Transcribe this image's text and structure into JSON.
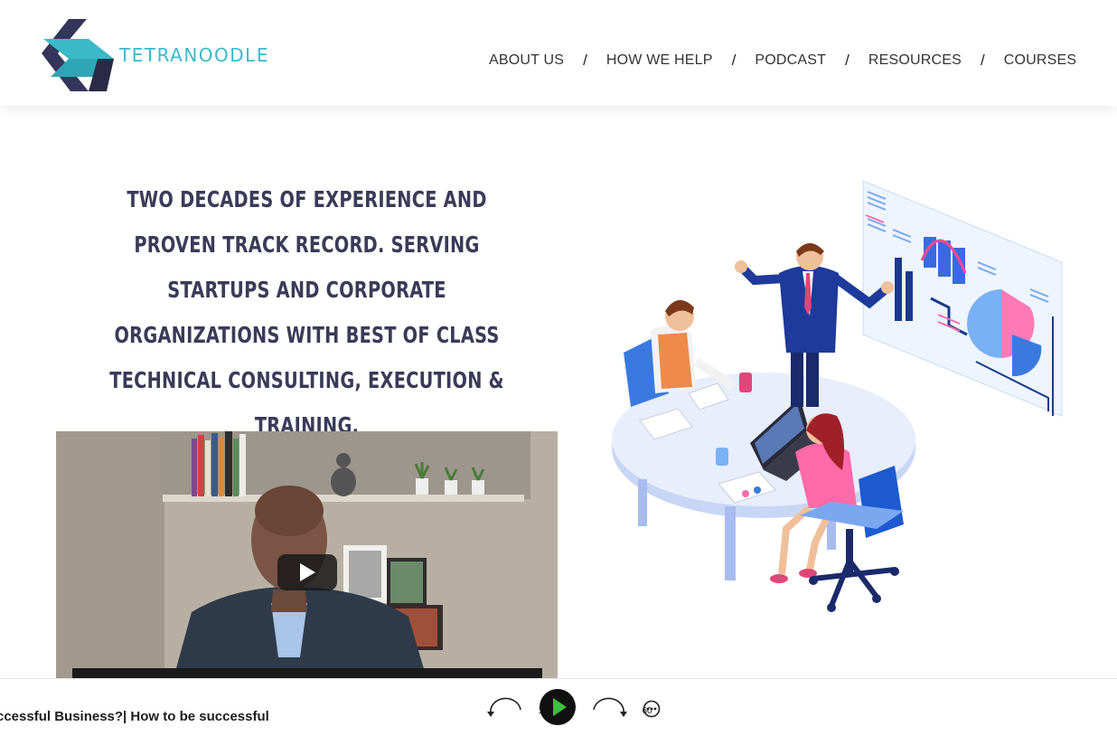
{
  "brand": {
    "name": "TETRANOODLE",
    "colors": {
      "teal": "#3bb9c9",
      "navy": "#35355a",
      "play_green": "#3fbf3f"
    }
  },
  "nav": {
    "items": [
      {
        "label": "ABOUT US"
      },
      {
        "label": "HOW WE HELP"
      },
      {
        "label": "PODCAST"
      },
      {
        "label": "RESOURCES"
      },
      {
        "label": "COURSES"
      }
    ],
    "separator": "/"
  },
  "hero": {
    "headline": "Two decades of experience and proven track record. Serving startups and corporate organizations with best of class technical consulting, execution & training."
  },
  "video": {
    "play_icon": "youtube-play-icon"
  },
  "illustration": {
    "icon": "team-meeting-illustration"
  },
  "player": {
    "episode_title": "ccessful Business?| How to be successful",
    "rewind_seconds": "15",
    "forward_seconds": "60",
    "play_icon": "play-icon",
    "more_icon": "more-options-icon"
  }
}
